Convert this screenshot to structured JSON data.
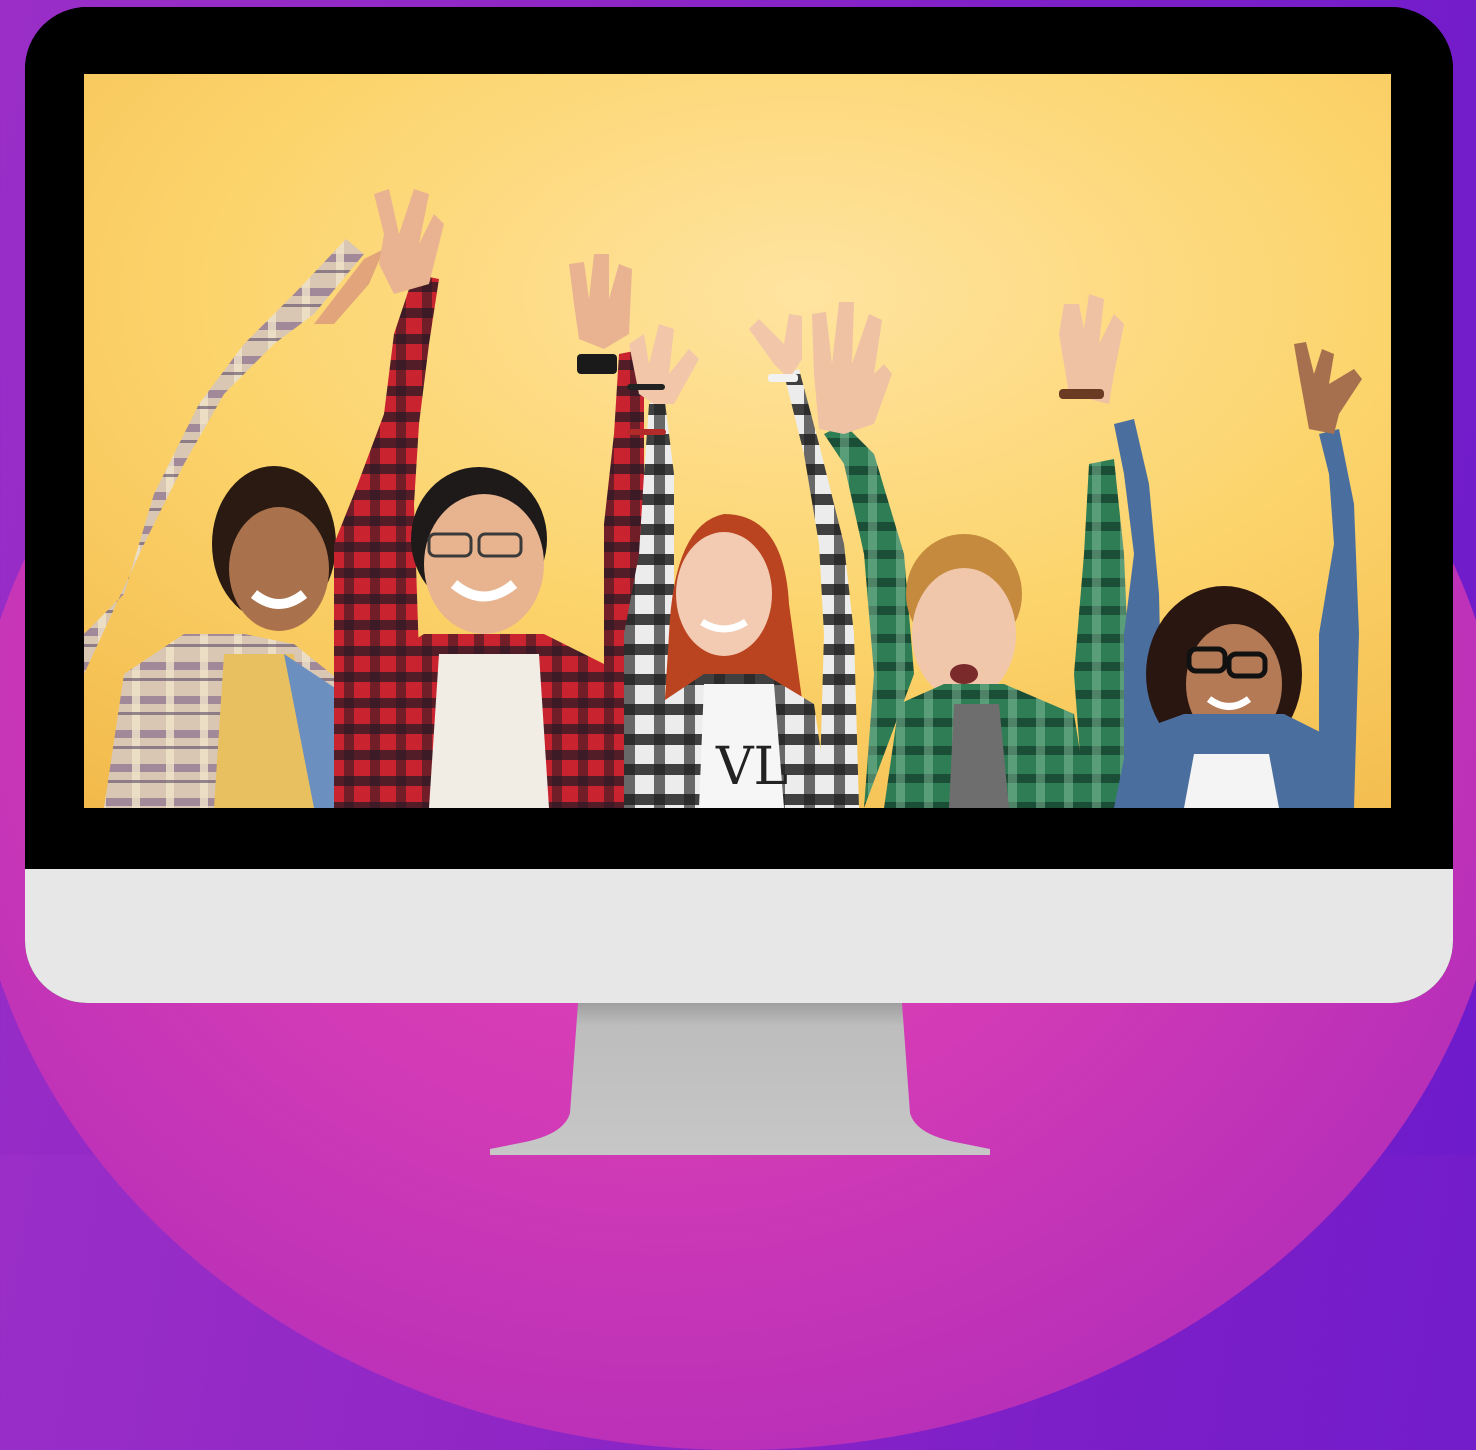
{
  "scene": {
    "description_icon": "monitor-icon",
    "colors": {
      "background_purple": "#8f26c5",
      "background_pink": "#d33bb6",
      "bezel": "#000000",
      "chin": "#e7e7e8",
      "stand": "#bdbdbd",
      "photo_backdrop": "#fcd46a"
    }
  }
}
